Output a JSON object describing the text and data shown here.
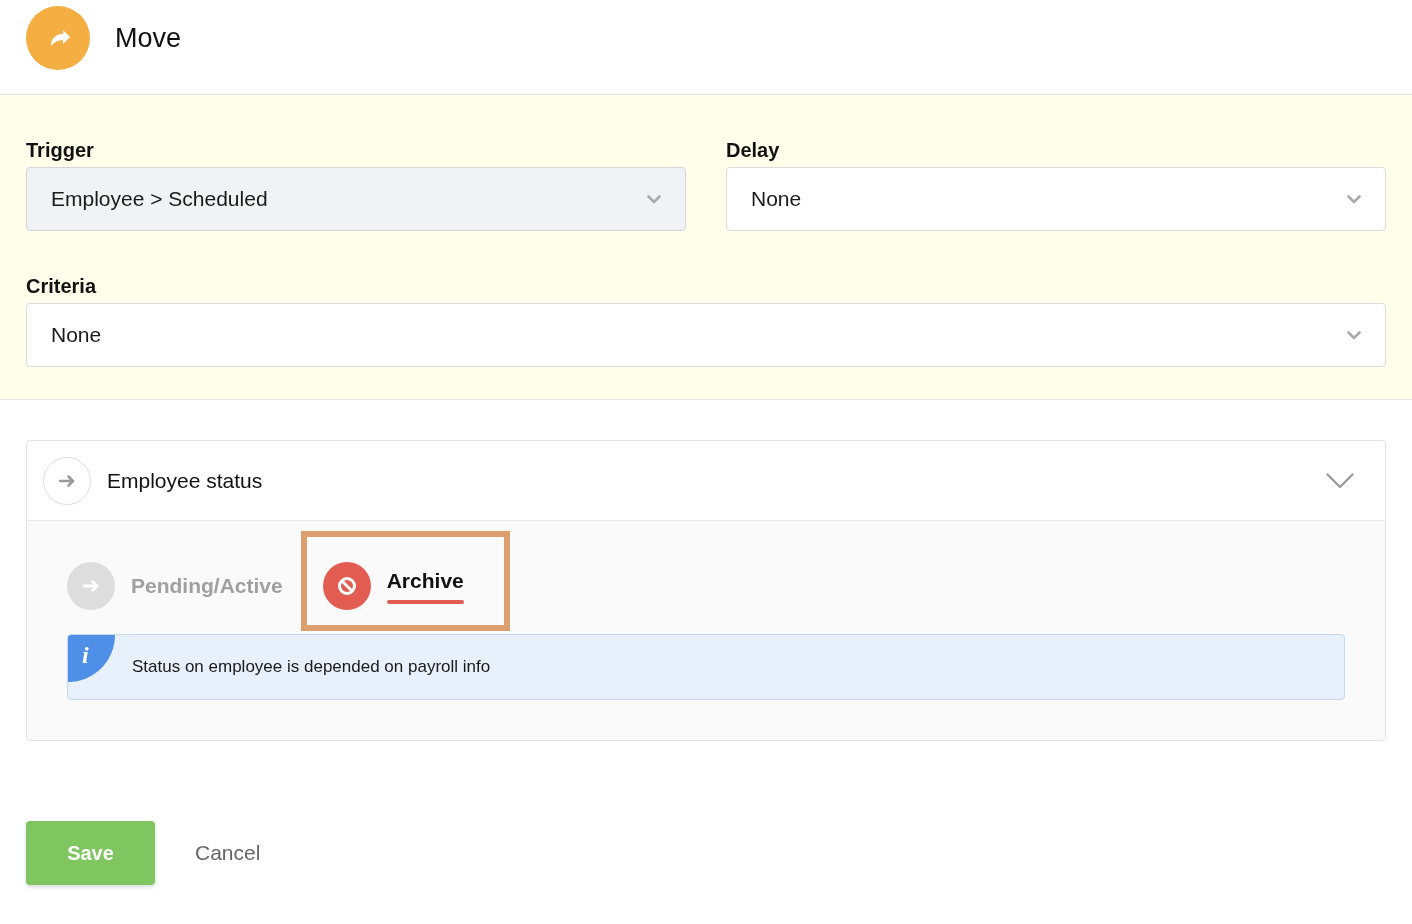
{
  "header": {
    "title": "Move"
  },
  "field_rows": [
    {
      "fields": [
        {
          "label": "Trigger",
          "value": "Employee > Scheduled",
          "disabled": true
        },
        {
          "label": "Delay",
          "value": "None",
          "disabled": false
        }
      ]
    },
    {
      "fields": [
        {
          "label": "Criteria",
          "value": "None",
          "disabled": false
        }
      ]
    }
  ],
  "action_card": {
    "title": "Employee status",
    "expanded": true,
    "options": [
      {
        "kind": "active",
        "label": "Pending/Active",
        "selected": false,
        "highlighted": false
      },
      {
        "kind": "archive",
        "label": "Archive",
        "selected": true,
        "highlighted": true
      }
    ],
    "info": {
      "badge": "i",
      "text": "Status on employee is depended on payroll info"
    }
  },
  "buttons": [
    {
      "kind": "primary",
      "label": "Save"
    },
    {
      "kind": "link",
      "label": "Cancel"
    }
  ]
}
